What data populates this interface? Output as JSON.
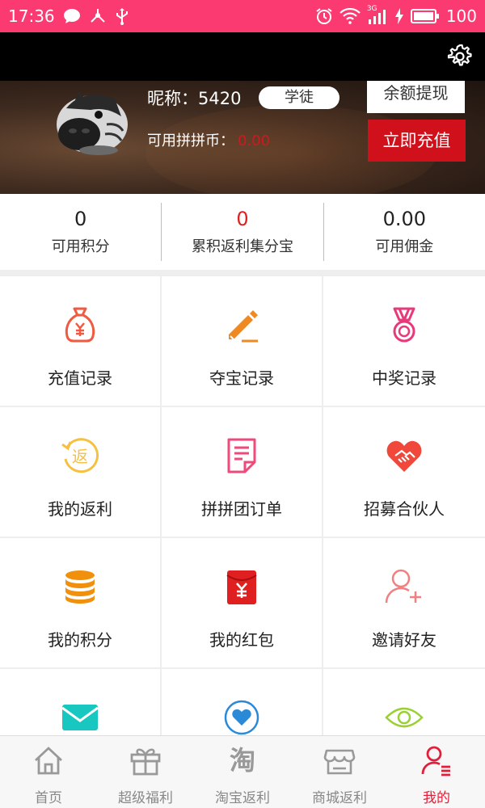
{
  "status_bar": {
    "time": "17:36",
    "signal_label": "3G",
    "battery": "100"
  },
  "header": {
    "settings_icon": "gear-icon"
  },
  "profile": {
    "nickname": "昵称：5420",
    "role": "学徒",
    "coins_label": "可用拼拼币：",
    "coins_value": "0.00",
    "withdraw_label": "余额提现",
    "recharge_label": "立即充值"
  },
  "stats": [
    {
      "value": "0",
      "label": "可用积分"
    },
    {
      "value": "0",
      "label": "累积返利集分宝"
    },
    {
      "value": "0.00",
      "label": "可用佣金"
    }
  ],
  "menu": [
    {
      "label": "充值记录",
      "icon": "money-bag-icon",
      "color": "#f05a40"
    },
    {
      "label": "夺宝记录",
      "icon": "pencil-icon",
      "color": "#f08a20"
    },
    {
      "label": "中奖记录",
      "icon": "medal-icon",
      "color": "#e83a7a"
    },
    {
      "label": "我的返利",
      "icon": "rebate-icon",
      "color": "#f6c040"
    },
    {
      "label": "拼拼团订单",
      "icon": "document-icon",
      "color": "#f04a7a"
    },
    {
      "label": "招募合伙人",
      "icon": "handshake-heart-icon",
      "color": "#f0483a"
    },
    {
      "label": "我的积分",
      "icon": "coin-stack-icon",
      "color": "#f0900c"
    },
    {
      "label": "我的红包",
      "icon": "red-packet-icon",
      "color": "#e02020"
    },
    {
      "label": "邀请好友",
      "icon": "add-user-icon",
      "color": "#f28080"
    },
    {
      "label": "",
      "icon": "mail-icon",
      "color": "#18c8c0"
    },
    {
      "label": "",
      "icon": "heart-circle-icon",
      "color": "#2a8ad8"
    },
    {
      "label": "",
      "icon": "eye-icon",
      "color": "#9ad030"
    }
  ],
  "tabbar": [
    {
      "label": "首页",
      "icon": "home-icon",
      "active": false
    },
    {
      "label": "超级福利",
      "icon": "gift-icon",
      "active": false
    },
    {
      "label": "淘宝返利",
      "icon": "taobao-icon",
      "glyph": "淘",
      "active": false
    },
    {
      "label": "商城返利",
      "icon": "store-icon",
      "active": false
    },
    {
      "label": "我的",
      "icon": "profile-icon",
      "active": true
    }
  ],
  "colors": {
    "status_bar": "#fb3a71",
    "recharge_button": "#d0101a",
    "active_tab": "#e0203a"
  }
}
